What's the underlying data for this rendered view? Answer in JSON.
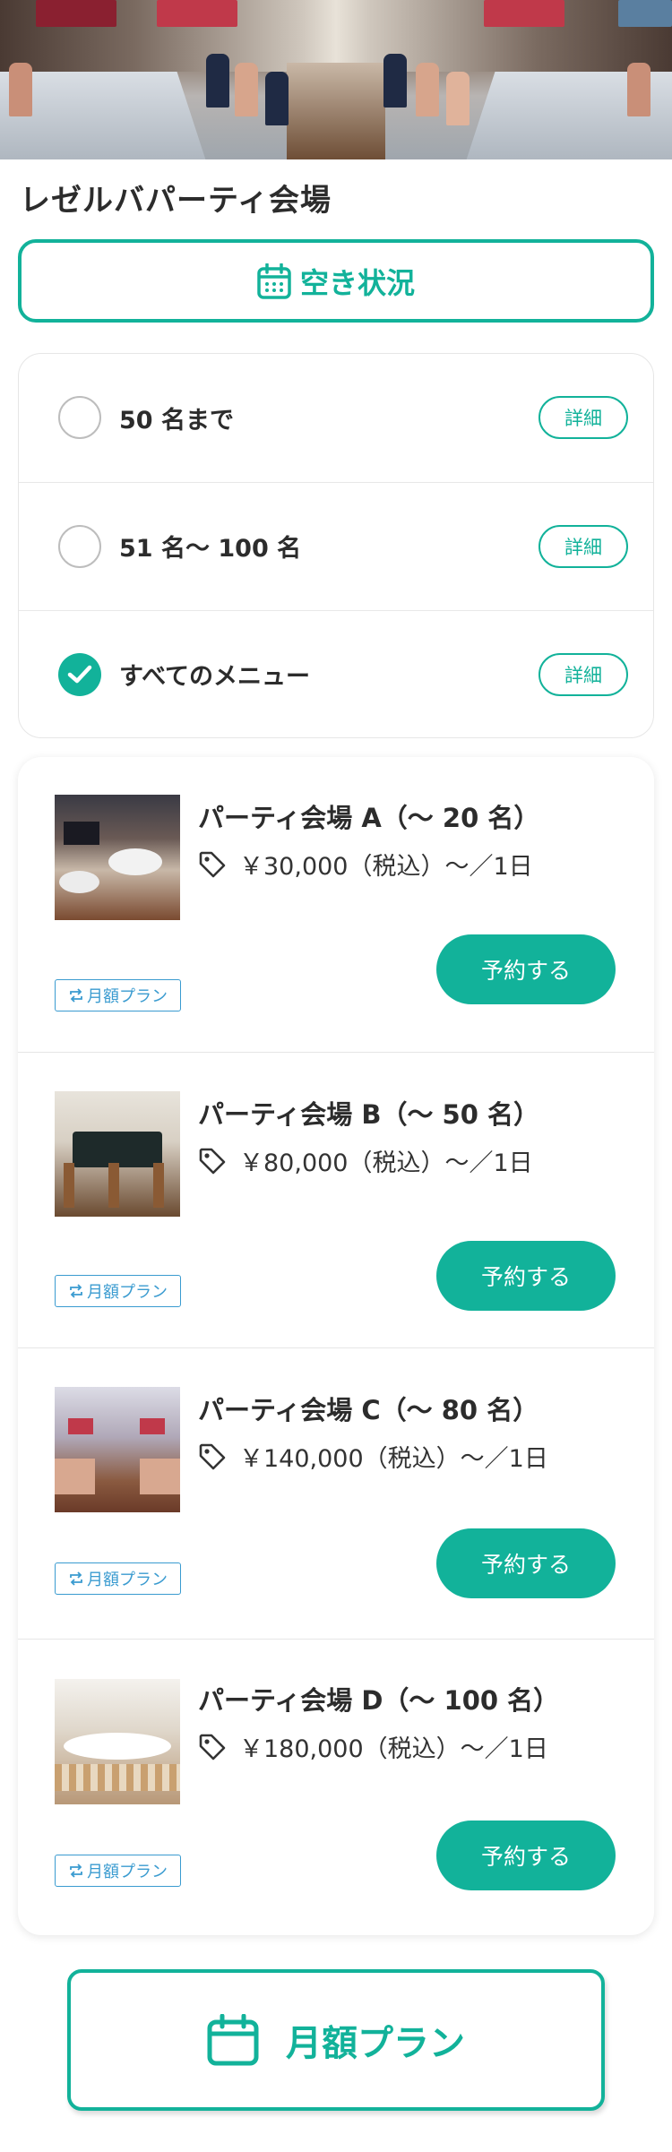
{
  "venue": {
    "title": "レゼルバパーティ会場"
  },
  "availability_button": {
    "label": "空き状況"
  },
  "filters": [
    {
      "label": "50 名まで",
      "checked": false,
      "detail_label": "詳細"
    },
    {
      "label": "51 名〜 100 名",
      "checked": false,
      "detail_label": "詳細"
    },
    {
      "label": "すべてのメニュー",
      "checked": true,
      "detail_label": "詳細"
    }
  ],
  "rooms": [
    {
      "name": "パーティ会場 A（〜 20 名）",
      "price": "￥30,000（税込）〜／1日",
      "reserve_label": "予約する",
      "badge": "月額プラン"
    },
    {
      "name": "パーティ会場 B（〜 50 名）",
      "price": "￥80,000（税込）〜／1日",
      "reserve_label": "予約する",
      "badge": "月額プラン"
    },
    {
      "name": "パーティ会場 C（〜 80 名）",
      "price": "￥140,000（税込）〜／1日",
      "reserve_label": "予約する",
      "badge": "月額プラン"
    },
    {
      "name": "パーティ会場 D（〜 100 名）",
      "price": "￥180,000（税込）〜／1日",
      "reserve_label": "予約する",
      "badge": "月額プラン"
    }
  ],
  "monthly_plan_button": {
    "label": "月額プラン"
  },
  "colors": {
    "accent": "#12b29a",
    "badge": "#3a9bd0",
    "text": "#2c2c2c"
  },
  "icons": {
    "calendar": "calendar-icon",
    "tag": "tag-icon",
    "check": "check-icon",
    "repeat": "repeat-icon"
  }
}
